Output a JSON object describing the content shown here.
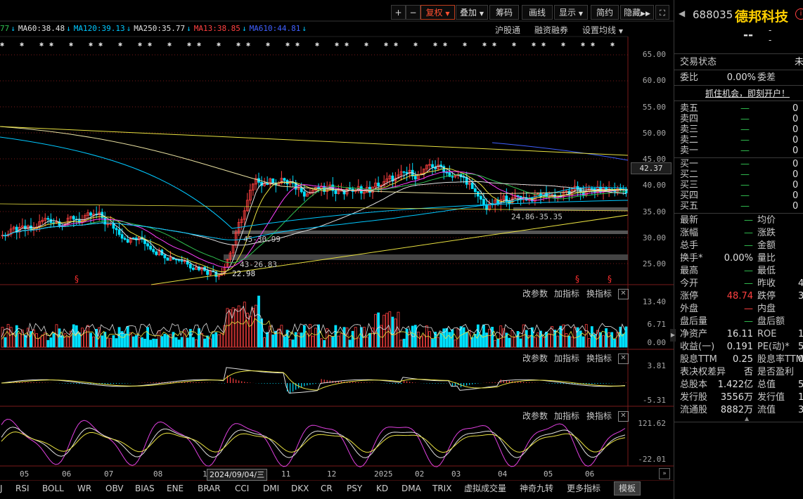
{
  "toolbar": {
    "plus": "+",
    "minus": "−",
    "fuquan": "复权",
    "diejia": "叠加",
    "chouma": "筹码",
    "huaxian": "画线",
    "xianshi": "显示",
    "jianyue": "简约",
    "yincang": "隐藏"
  },
  "ma_legend": [
    {
      "text": "77",
      "color": "#30c050"
    },
    {
      "text": "MA60:38.48",
      "color": "#e0e0e0"
    },
    {
      "text": "MA120:39.13",
      "color": "#00c8ff"
    },
    {
      "text": "MA250:35.77",
      "color": "#e0e0e0"
    },
    {
      "text": "MA13:38.85",
      "color": "#ff4040"
    },
    {
      "text": "MA610:44.81",
      "color": "#4060ff"
    }
  ],
  "chart_tools": {
    "hugutong": "沪股通",
    "rongzi": "融资融券",
    "junxian": "设置均线"
  },
  "price_axis": [
    "65.00",
    "60.00",
    "55.00",
    "50.00",
    "45.00",
    "40.00",
    "35.00",
    "30.00",
    "25.00"
  ],
  "current_price_tag": "42.37",
  "annotations": {
    "a1": "24.86-35.35",
    "a2": "45-30.99",
    "a3": "43-26.83",
    "a4": "22.98"
  },
  "sub_panel_tools": {
    "gaicanshu": "改参数",
    "jiazhibiao": "加指标",
    "huanzhibiao": "换指标"
  },
  "volume_axis": [
    "13.40",
    "6.71",
    "0.00"
  ],
  "macd_axis": [
    "3.81",
    "-5.31"
  ],
  "kdj_axis": [
    "121.62",
    "-22.01"
  ],
  "months": [
    "05",
    "06",
    "07",
    "08",
    "10",
    "11",
    "12",
    "2025",
    "02",
    "03",
    "04",
    "05",
    "06"
  ],
  "date_tag": "2024/09/04/三",
  "bottom_tabs": [
    "J",
    "RSI",
    "BOLL",
    "WR",
    "OBV",
    "BIAS",
    "ENE",
    "BRAR",
    "CCI",
    "DMI",
    "DKX",
    "CR",
    "PSY",
    "KD",
    "DMA",
    "TRIX",
    "虚拟成交量",
    "神奇九转",
    "更多指标",
    "模板"
  ],
  "stock": {
    "code": "688035",
    "name": "德邦科技",
    "price": "--",
    "change": "-",
    "change_pct": "-"
  },
  "trade_status": {
    "label": "交易状态",
    "value": "未"
  },
  "weibi": {
    "label": "委比",
    "value": "0.00%",
    "label2": "委差"
  },
  "promo": "抓住机会，即刻开户！",
  "sell_levels": [
    {
      "label": "卖五",
      "price": "—",
      "vol": "0"
    },
    {
      "label": "卖四",
      "price": "—",
      "vol": "0"
    },
    {
      "label": "卖三",
      "price": "—",
      "vol": "0"
    },
    {
      "label": "卖二",
      "price": "—",
      "vol": "0"
    },
    {
      "label": "卖一",
      "price": "—",
      "vol": "0"
    }
  ],
  "buy_levels": [
    {
      "label": "买一",
      "price": "—",
      "vol": "0"
    },
    {
      "label": "买二",
      "price": "—",
      "vol": "0"
    },
    {
      "label": "买三",
      "price": "—",
      "vol": "0"
    },
    {
      "label": "买四",
      "price": "—",
      "vol": "0"
    },
    {
      "label": "买五",
      "price": "—",
      "vol": "0"
    }
  ],
  "quote_rows": [
    {
      "k1": "最新",
      "v1": "—",
      "k2": "均价",
      "v2": ""
    },
    {
      "k1": "涨幅",
      "v1": "—",
      "k2": "涨跌",
      "v2": ""
    },
    {
      "k1": "总手",
      "v1": "—",
      "k2": "金额",
      "v2": ""
    },
    {
      "k1": "换手*",
      "v1": "0.00%",
      "k2": "量比",
      "v2": ""
    },
    {
      "k1": "最高",
      "v1": "—",
      "k2": "最低",
      "v2": ""
    },
    {
      "k1": "今开",
      "v1": "—",
      "k2": "昨收",
      "v2": "4"
    },
    {
      "k1": "涨停",
      "v1": "48.74",
      "k2": "跌停",
      "v2": "3"
    },
    {
      "k1": "外盘",
      "v1": "—",
      "k2": "内盘",
      "v2": ""
    },
    {
      "k1": "盘后量",
      "v1": "—",
      "k2": "盘后额",
      "v2": ""
    },
    {
      "k1": "净资产",
      "v1": "16.11",
      "k2": "ROE",
      "v2": "1"
    },
    {
      "k1": "收益(一)",
      "v1": "0.191",
      "k2": "PE(动)*",
      "v2": "5"
    },
    {
      "k1": "股息TTM",
      "v1": "0.25",
      "k2": "股息率TTM",
      "v2": "0"
    },
    {
      "k1": "表决权差异",
      "v1": "否",
      "k2": "是否盈利",
      "v2": ""
    },
    {
      "k1": "总股本",
      "v1": "1.422亿",
      "k2": "总值",
      "v2": "57."
    },
    {
      "k1": "发行股",
      "v1": "3556万",
      "k2": "发行值",
      "v2": "14."
    },
    {
      "k1": "流通股",
      "v1": "8882万",
      "k2": "流值",
      "v2": "36."
    }
  ],
  "colors": {
    "up": "#ff4040",
    "down": "#00e0ff",
    "grid": "#7a1a1a",
    "ma_yellow": "#e8e040",
    "ma_white": "#e0e0e0",
    "ma_blue": "#4060ff",
    "ma_pink": "#ff40ff",
    "ma_green": "#30c050",
    "ma_cyan": "#00c8ff"
  }
}
